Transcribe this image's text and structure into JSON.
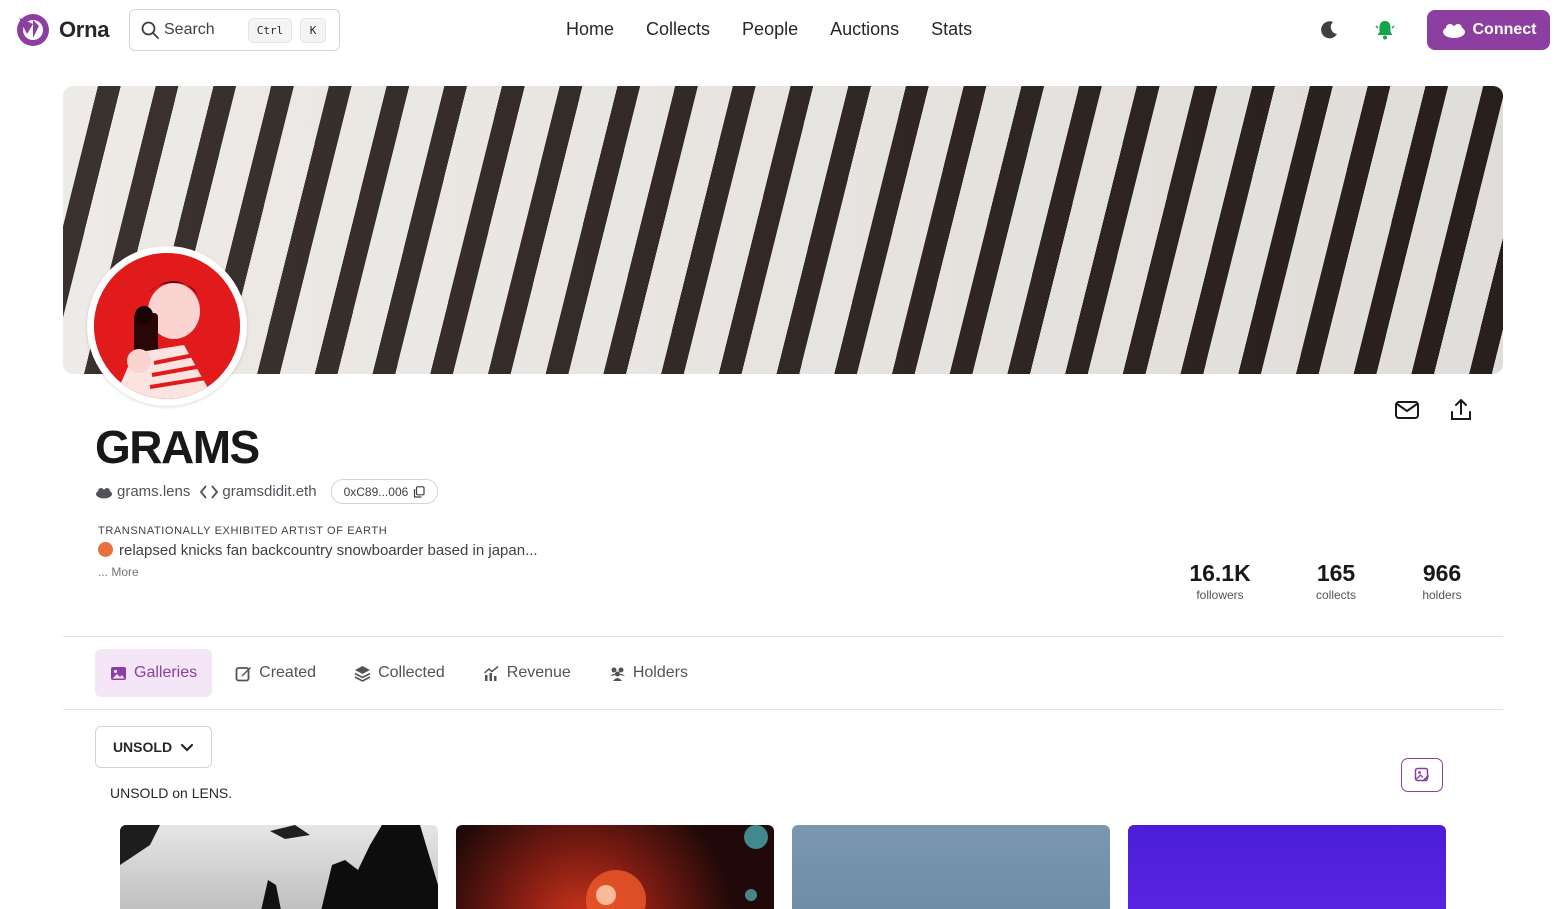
{
  "nav": {
    "brand": "Orna",
    "search": {
      "placeholder": "Search",
      "shortcut_mod": "Ctrl",
      "shortcut_key": "K"
    },
    "links": [
      "Home",
      "Collects",
      "People",
      "Auctions",
      "Stats"
    ],
    "connect_label": "Connect",
    "icons": {
      "theme": "moon-icon",
      "notifications": "bell-icon"
    }
  },
  "profile": {
    "name": "GRAMS",
    "lens_handle": "grams.lens",
    "ens_handle": "gramsdidit.eth",
    "address": "0xC89...006",
    "bio_tag": "TRANSNATIONALLY EXHIBITED ARTIST OF EARTH",
    "bio_text": "relapsed knicks fan backcountry snowboarder based in japan...",
    "bio_more": "... More"
  },
  "stats": [
    {
      "value": "16.1K",
      "label": "followers"
    },
    {
      "value": "165",
      "label": "collects"
    },
    {
      "value": "966",
      "label": "holders"
    }
  ],
  "tabs": [
    {
      "label": "Galleries",
      "active": true
    },
    {
      "label": "Created",
      "active": false
    },
    {
      "label": "Collected",
      "active": false
    },
    {
      "label": "Revenue",
      "active": false
    },
    {
      "label": "Holders",
      "active": false
    }
  ],
  "gallery": {
    "filter_value": "UNSOLD",
    "caption": "UNSOLD on LENS."
  },
  "colors": {
    "brand": "#8c3fa0",
    "bell": "#16a34a",
    "active_tab_bg": "#f4e6f7"
  }
}
